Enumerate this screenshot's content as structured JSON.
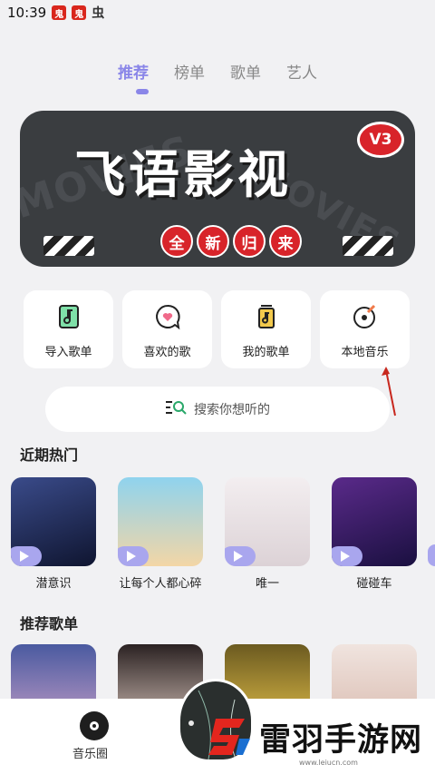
{
  "status": {
    "time": "10:39",
    "icons": [
      "鬼",
      "鬼"
    ],
    "extra_icon": "虫"
  },
  "tabs": [
    {
      "label": "推荐",
      "active": true
    },
    {
      "label": "榜单",
      "active": false
    },
    {
      "label": "歌单",
      "active": false
    },
    {
      "label": "艺人",
      "active": false
    }
  ],
  "banner": {
    "title": "飞语影视",
    "badge": "V3",
    "subtitle_chars": [
      "全",
      "新",
      "归",
      "来"
    ],
    "bg_words": [
      "MOVIES",
      "MOVIES"
    ]
  },
  "quick_actions": [
    {
      "label": "导入歌单",
      "icon": "import-playlist-icon"
    },
    {
      "label": "喜欢的歌",
      "icon": "favorite-songs-icon"
    },
    {
      "label": "我的歌单",
      "icon": "my-playlist-icon"
    },
    {
      "label": "本地音乐",
      "icon": "local-music-icon"
    }
  ],
  "search": {
    "placeholder": "搜索你想听的",
    "icon": "search-icon"
  },
  "recent_hot": {
    "title": "近期热门",
    "items": [
      {
        "title": "潜意识",
        "color": "#1d2a55"
      },
      {
        "title": "让每个人都心碎",
        "color": "#7fc6e3"
      },
      {
        "title": "唯一",
        "color": "#e9e2e4"
      },
      {
        "title": "碰碰车",
        "color": "#2a1b5a"
      }
    ]
  },
  "recommended": {
    "title": "推荐歌单",
    "items": [
      {
        "color": "#3b4a8a"
      },
      {
        "color": "#c9b8b0"
      },
      {
        "color": "#c9a23a"
      },
      {
        "color": "#e8d8d2"
      }
    ]
  },
  "bottom_nav": {
    "label": "音乐圈",
    "icon": "music-circle-icon"
  },
  "watermark": {
    "text": "雷羽手游网",
    "url": "www.leiucn.com"
  },
  "colors": {
    "accent": "#8a86e8",
    "background": "#f1f1f3",
    "banner_red": "#d8242a"
  }
}
